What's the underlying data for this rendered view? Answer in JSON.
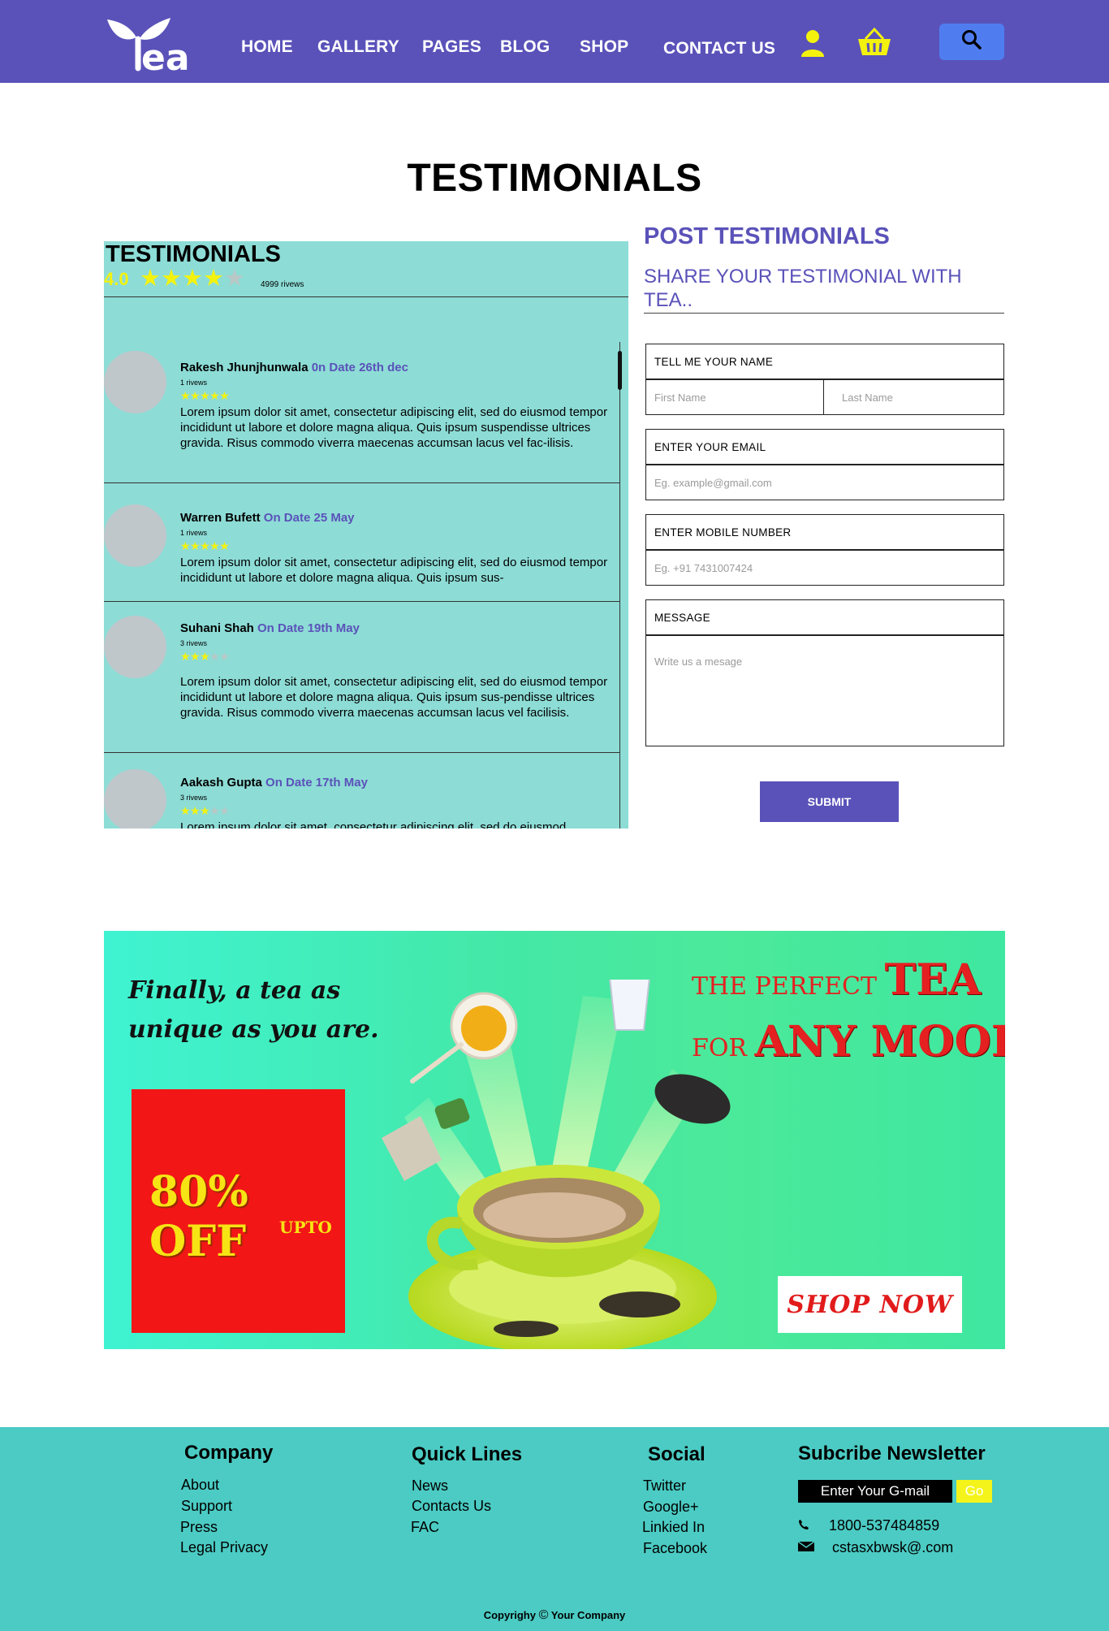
{
  "nav": {
    "logo_text": "Tea",
    "links": [
      "HOME",
      "GALLERY",
      "PAGES",
      "BLOG",
      "SHOP",
      "CONTACT US"
    ],
    "accent": "#5a52b9"
  },
  "page_title": "TESTIMONIALS",
  "reviews_panel": {
    "title": "TESTIMONIALS",
    "rating": "4.0",
    "rating_stars": 4,
    "rating_count": "4999 rivews",
    "reviews": [
      {
        "name": "Rakesh Jhunjhunwala",
        "date": "0n Date 26th dec",
        "count": "1 rivews",
        "stars": 5,
        "text": "Lorem ipsum dolor sit amet, consectetur adipiscing elit, sed do eiusmod tempor incididunt ut labore et dolore magna aliqua. Quis ipsum suspendisse ultrices gravida. Risus commodo viverra maecenas accumsan lacus vel fac-ilisis."
      },
      {
        "name": "Warren Bufett",
        "date": "On Date 25 May",
        "count": "1 rivews",
        "stars": 5,
        "text": "Lorem ipsum dolor sit amet, consectetur adipiscing elit, sed do eiusmod tempor incididunt ut labore et dolore magna aliqua. Quis ipsum sus-"
      },
      {
        "name": "Suhani Shah",
        "date": "On Date 19th May",
        "count": "3 rivews",
        "stars": 3,
        "text": "Lorem ipsum dolor sit amet, consectetur adipiscing elit, sed do eiusmod tempor incididunt ut labore et dolore magna aliqua. Quis ipsum sus-pendisse ultrices gravida. Risus commodo viverra maecenas accumsan lacus vel facilisis."
      },
      {
        "name": "Aakash Gupta",
        "date": "On Date 17th May",
        "count": "3 rivews",
        "stars": 3,
        "text": "Lorem ipsum dolor sit amet, consectetur adipiscing elit, sed do eiusmod"
      }
    ]
  },
  "post_form": {
    "title": "POST TESTIMONIALS",
    "subtitle": "SHARE YOUR TESTIMONIAL WITH TEA..",
    "name_label": "TELL ME YOUR NAME",
    "first_name_placeholder": "First Name",
    "last_name_placeholder": "Last Name",
    "email_label": "ENTER YOUR EMAIL",
    "email_placeholder": "Eg. example@gmail.com",
    "mobile_label": "ENTER MOBILE NUMBER",
    "mobile_placeholder": "Eg. +91 7431007424",
    "message_label": "MESSAGE",
    "message_placeholder": "Write us a mesage",
    "submit_label": "SUBMIT"
  },
  "promo": {
    "tagline_line1": "Finally, a tea as",
    "tagline_line2": "unique as you are.",
    "discount": "80% OFF",
    "discount_sub": "UPTO",
    "slogan_a": "THE PERFECT",
    "slogan_a_big": "TEA",
    "slogan_b": "FOR",
    "slogan_b_big": "ANY MOOD.",
    "cta": "SHOP NOW",
    "colors": {
      "discount_bg": "#f21616",
      "discount_text": "#f7e414",
      "slogan": "#e52020"
    }
  },
  "footer": {
    "company": {
      "title": "Company",
      "links": [
        "About",
        "Support",
        "Press",
        "Legal Privacy"
      ]
    },
    "quick": {
      "title": "Quick Lines",
      "links": [
        "News",
        "Contacts Us",
        "FAC"
      ]
    },
    "social": {
      "title": "Social",
      "links": [
        "Twitter",
        "Google+",
        "Linkied In",
        "Facebook"
      ]
    },
    "newsletter": {
      "title": "Subcribe Newsletter",
      "input_placeholder": "Enter Your G-mail",
      "go_label": "Go",
      "phone": "1800-537484859",
      "email": "cstasxbwsk@.com"
    },
    "copyright_a": "Copyrighy",
    "copyright_symbol": "©",
    "copyright_b": "Your Company",
    "bg": "#4bcbc3"
  }
}
